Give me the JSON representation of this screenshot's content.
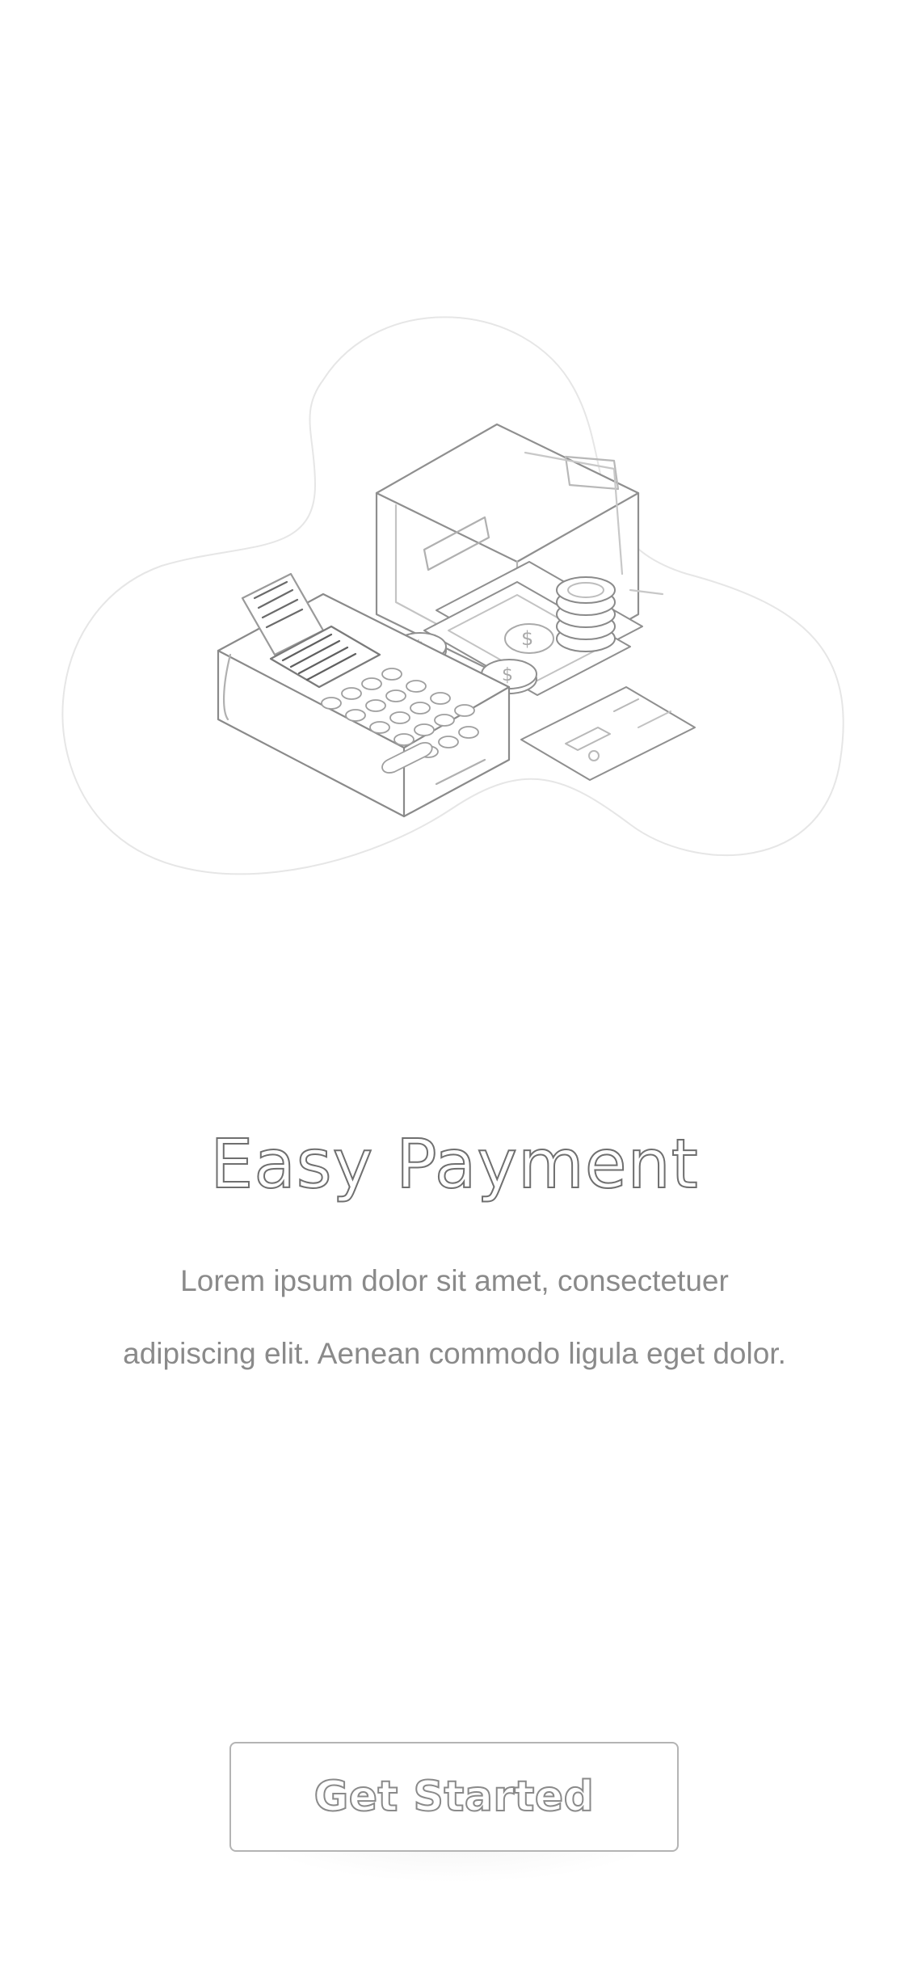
{
  "onboarding": {
    "title": "Easy Payment",
    "description": "Lorem ipsum dolor sit amet, consectetuer adipiscing elit. Aenean commodo ligula eget dolor.",
    "cta_label": "Get Started"
  },
  "illustration": {
    "icon": "payment-terminal-wallet-illustration",
    "stroke_color": "#9a9a9a",
    "blob_color": "#e6e6e6"
  }
}
